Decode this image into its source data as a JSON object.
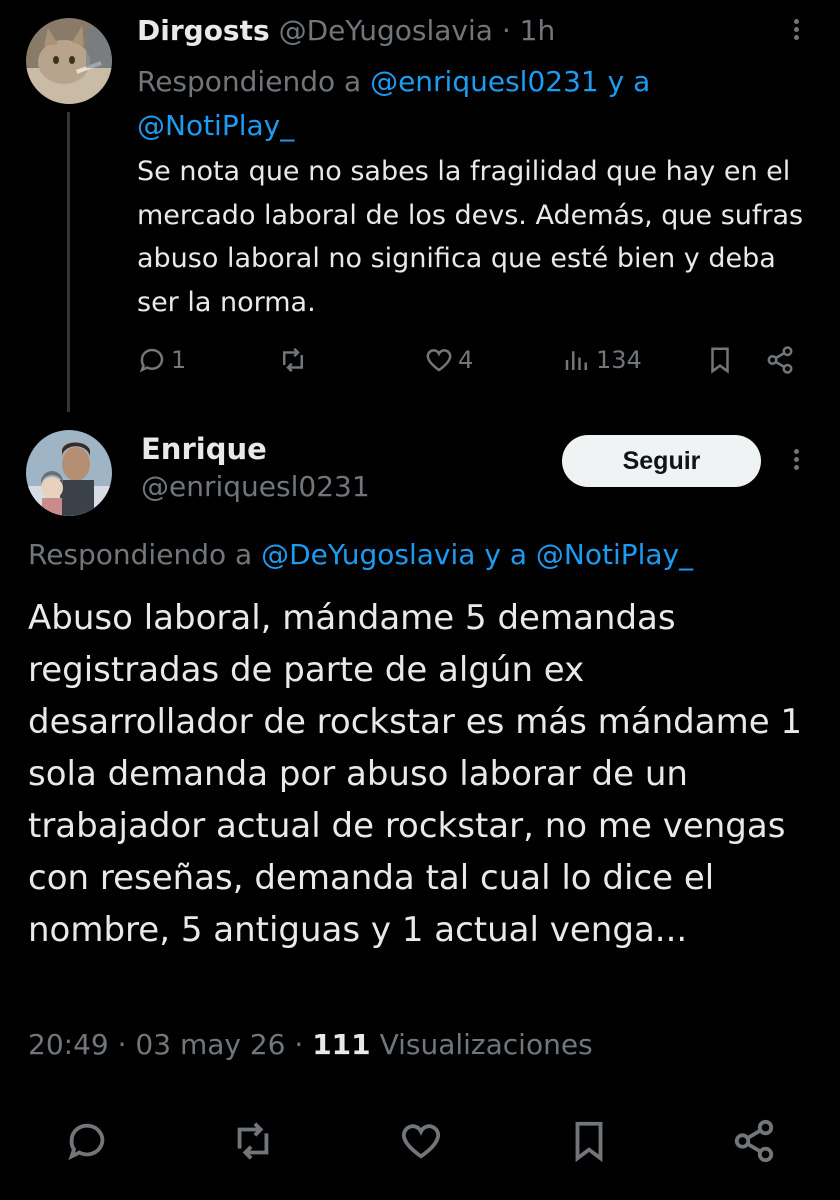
{
  "reply": {
    "name": "Dirgosts",
    "handle": "@DeYugoslavia",
    "separator": "·",
    "time": "1h",
    "replying_prefix": "Respondiendo a",
    "replying_mention_1": "@enriquesl0231",
    "replying_joiner": "y a",
    "replying_mention_2": "@NotiPlay_",
    "text": "Se nota que no sabes la fragilidad que hay en el mercado laboral de los devs. Además, que sufras abuso laboral no significa que esté bien y deba ser la norma.",
    "actions": {
      "replies": "1",
      "retweets": "",
      "likes": "4",
      "views": "134"
    }
  },
  "main": {
    "name": "Enrique",
    "handle": "@enriquesl0231",
    "follow_label": "Seguir",
    "replying_prefix": "Respondiendo a",
    "replying_mention_1": "@DeYugoslavia",
    "replying_joiner": "y a",
    "replying_mention_2": "@NotiPlay_",
    "text": "Abuso laboral, mándame 5 demandas registradas de parte de algún ex desarrollador de rockstar es más mándame 1 sola demanda por abuso laborar de un trabajador actual de rockstar, no me vengas con reseñas, demanda tal cual lo dice el nombre, 5 antiguas y 1 actual venga...",
    "time": "20:49",
    "separator": "·",
    "date": "03 may 26",
    "views_count": "111",
    "views_label": "Visualizaciones"
  },
  "icons": [
    "reply-icon",
    "retweet-icon",
    "like-icon",
    "views-icon",
    "bookmark-icon",
    "share-icon",
    "more-icon"
  ],
  "colors": {
    "background": "#000000",
    "text": "#e7e9ea",
    "muted": "#71767b",
    "link": "#1d9bf0",
    "follow_bg": "#eff3f4"
  }
}
